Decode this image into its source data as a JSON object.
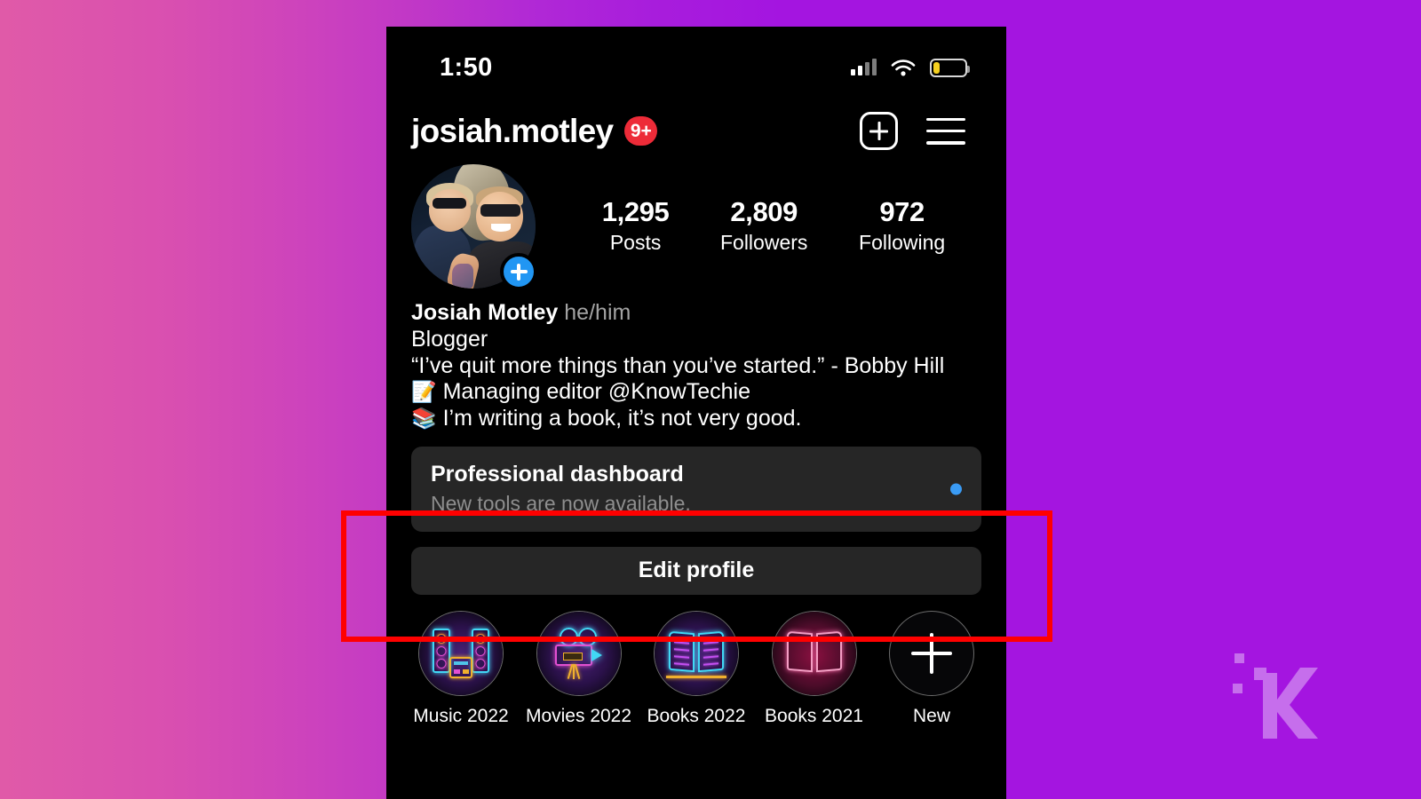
{
  "background": {
    "gradient_left": "#e05aa8",
    "gradient_right": "#a415e0"
  },
  "watermark": {
    "brand": "K",
    "name": "knowtechie-logo"
  },
  "annotation": {
    "color": "#ff0000",
    "shape": "rectangle"
  },
  "phone": {
    "status_bar": {
      "time": "1:50",
      "signal": "cellular-signal-icon",
      "wifi": "wifi-icon",
      "battery": "battery-low-icon",
      "battery_level": "20%",
      "battery_color": "#f5d020"
    },
    "header": {
      "username": "josiah.motley",
      "notification_badge": "9+",
      "badge_color": "#ed2b38",
      "create_label": "new-post-icon",
      "menu_label": "hamburger-menu-icon"
    },
    "profile": {
      "avatar_alt": "profile-photo",
      "add_story_label": "+",
      "stats": [
        {
          "value": "1,295",
          "label": "Posts"
        },
        {
          "value": "2,809",
          "label": "Followers"
        },
        {
          "value": "972",
          "label": "Following"
        }
      ],
      "bio": {
        "display_name": "Josiah Motley",
        "pronouns": "he/him",
        "category": "Blogger",
        "line1": "“I’ve quit more things than you’ve started.” - Bobby Hill",
        "line2_emoji": "📝",
        "line2": "Managing editor @KnowTechie",
        "line3_emoji": "📚",
        "line3": "I’m writing a book, it’s not very good."
      }
    },
    "dashboard": {
      "title": "Professional dashboard",
      "subtitle": "New tools are now available.",
      "dot_color": "#3a9bf5"
    },
    "edit_profile": {
      "label": "Edit profile"
    },
    "highlights": [
      {
        "label": "Music 2022",
        "icon": "neon-stereo-speakers-icon"
      },
      {
        "label": "Movies 2022",
        "icon": "neon-movie-camera-icon"
      },
      {
        "label": "Books 2022",
        "icon": "neon-open-book-icon"
      },
      {
        "label": "Books 2021",
        "icon": "pink-open-book-icon"
      },
      {
        "label": "New",
        "icon": "plus-icon"
      }
    ]
  }
}
